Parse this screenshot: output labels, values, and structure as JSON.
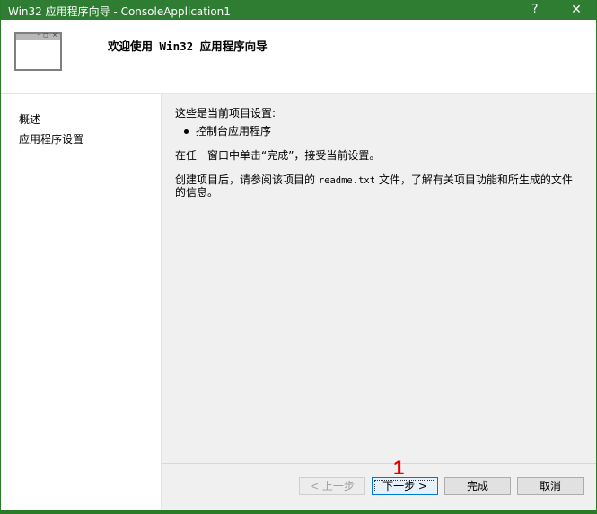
{
  "window": {
    "title": "Win32 应用程序向导 - ConsoleApplication1",
    "help_label": "?",
    "close_label": "✕"
  },
  "header": {
    "heading": "欢迎使用 Win32 应用程序向导",
    "icon": "wizard-window-icon",
    "icon_controls": "- ◻ ×"
  },
  "nav": {
    "items": [
      {
        "label": "概述"
      },
      {
        "label": "应用程序设置"
      }
    ]
  },
  "content": {
    "intro": "这些是当前项目设置:",
    "settings": [
      "控制台应用程序"
    ],
    "instruction": "在任一窗口中单击“完成”，接受当前设置。",
    "readme_prefix": "创建项目后，请参阅该项目的 ",
    "readme_file": "readme.txt",
    "readme_suffix": " 文件，了解有关项目功能和所生成的文件",
    "readme_line2": "的信息。"
  },
  "buttons": {
    "prev": "< 上一步",
    "next": "下一步 >",
    "finish": "完成",
    "cancel": "取消"
  },
  "annotation": {
    "step_number": "1",
    "color": "#e00000"
  },
  "colors": {
    "titlebar": "#2e7d32",
    "focus_border": "#0078d7"
  }
}
